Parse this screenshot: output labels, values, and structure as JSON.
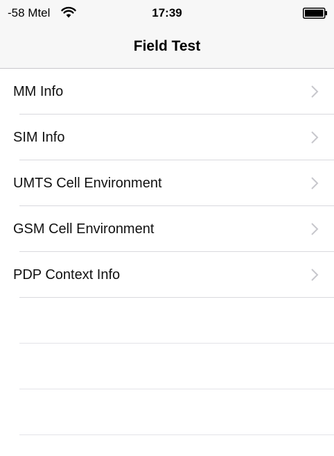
{
  "status_bar": {
    "carrier": "-58 Mtel",
    "time": "17:39"
  },
  "nav": {
    "title": "Field Test"
  },
  "menu": {
    "items": [
      {
        "label": "MM Info"
      },
      {
        "label": "SIM Info"
      },
      {
        "label": "UMTS Cell Environment"
      },
      {
        "label": "GSM Cell Environment"
      },
      {
        "label": "PDP Context Info"
      }
    ]
  },
  "icons": {
    "wifi": "wifi-icon",
    "battery": "battery-icon",
    "chevron": "chevron-right-icon"
  },
  "colors": {
    "bar_background": "#f7f7f7",
    "separator": "#d9d9de",
    "chevron": "#c7c7cc"
  }
}
